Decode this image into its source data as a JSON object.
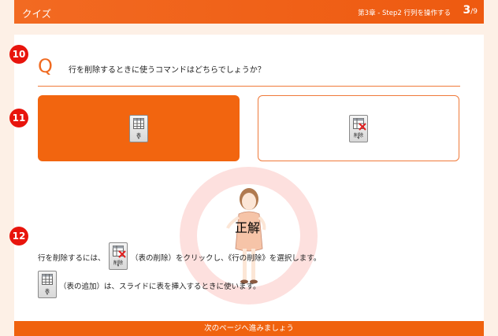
{
  "header": {
    "title": "クイズ",
    "chapter": "第3章 - Step2 行列を操作する",
    "page_current": "3",
    "page_total": "/9"
  },
  "markers": [
    "10",
    "11",
    "12"
  ],
  "question": {
    "letter": "Q",
    "text": "行を削除するときに使うコマンドはどちらでしょうか？"
  },
  "choices": [
    {
      "icon": "table-icon",
      "caption": "表"
    },
    {
      "icon": "delete-table-icon",
      "caption": "削除"
    }
  ],
  "result": {
    "label": "正解"
  },
  "explanation": {
    "line1_before": "行を削除するには、",
    "line1_icon_caption": "削除",
    "line1_after": "（表の削除）をクリックし、《行の削除》を選択します。",
    "line2_icon_caption": "表",
    "line2_after": "（表の追加）は、スライドに表を挿入するときに使います。"
  },
  "footer": {
    "next_label": "次のページへ進みましょう"
  },
  "colors": {
    "accent": "#f2650f",
    "marker": "#e8140c",
    "halo": "#fde0de"
  }
}
